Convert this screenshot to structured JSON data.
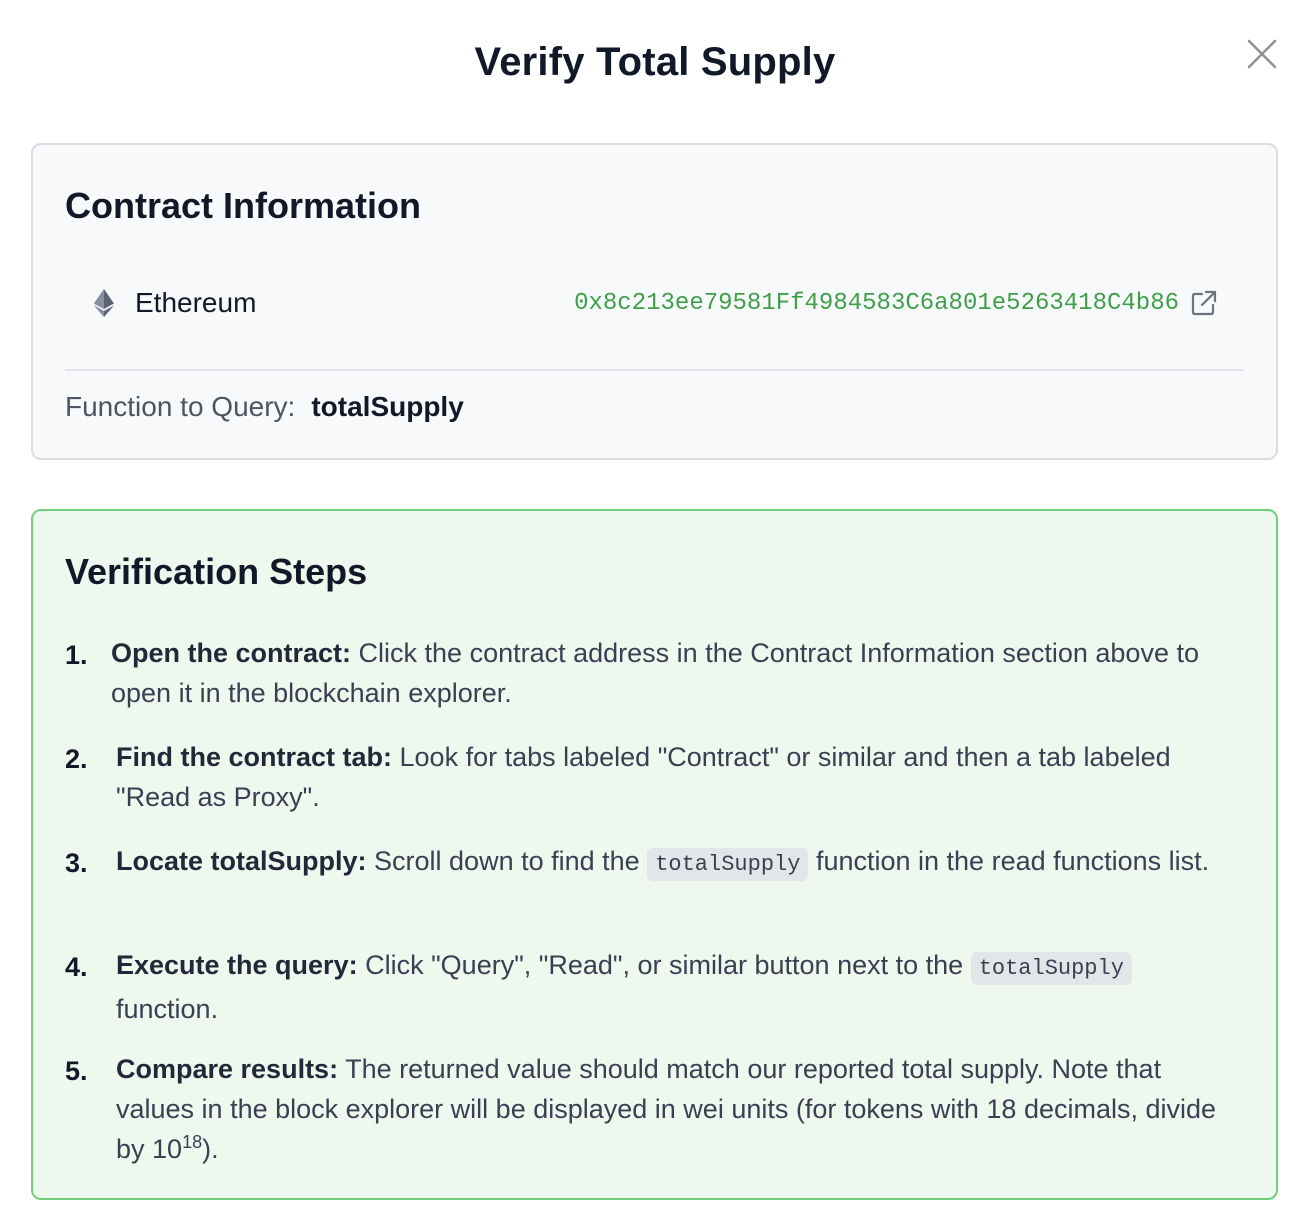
{
  "modal": {
    "title": "Verify Total Supply"
  },
  "contract": {
    "section_title": "Contract Information",
    "chain_name": "Ethereum",
    "address": "0x8c213ee79581Ff4984583C6a801e5263418C4b86",
    "function_label": "Function to Query:",
    "function_name": "totalSupply"
  },
  "steps": {
    "section_title": "Verification Steps",
    "items": [
      {
        "num": "1.",
        "bold": "Open the contract:",
        "text": "Click the contract address in the Contract Information section above to open it in the blockchain explorer."
      },
      {
        "num": "2.",
        "bold": "Find the contract tab:",
        "text": "Look for tabs labeled \"Contract\" or similar and then a tab labeled \"Read as Proxy\"."
      },
      {
        "num": "3.",
        "bold": "Locate totalSupply:",
        "text_before": "Scroll down to find the",
        "code": "totalSupply",
        "text_after": "function in the read functions list."
      },
      {
        "num": "4.",
        "bold": "Execute the query:",
        "text_before": "Click \"Query\", \"Read\", or similar button next to the",
        "code": "totalSupply",
        "text_after": "function."
      },
      {
        "num": "5.",
        "bold": "Compare results:",
        "text": "The returned value should match our reported total supply. Note that values in the block explorer will be displayed in wei units (for tokens with 18 decimals, divide by 10",
        "sup": "18",
        "text_end": ")."
      }
    ]
  },
  "colors": {
    "address_green": "#3f9f49",
    "steps_bg": "#eff8ef",
    "steps_border": "#6fcf7a",
    "info_bg": "#f8f9fb"
  },
  "icons": {
    "close": "close-icon",
    "chain": "ethereum-icon",
    "external": "external-link-icon"
  }
}
